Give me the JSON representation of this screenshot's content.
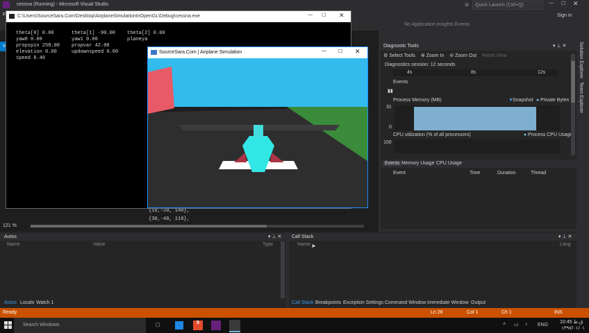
{
  "vs": {
    "title": "cessna (Running) - Microsoft Visual Studio",
    "quick_launch": "Quick Launch (Ctrl+Q)",
    "menu_file": "File",
    "sign_in": "Sign in",
    "app_insights": "No Application Insights Events",
    "editor_tab": "ver",
    "toolbar_left": "Pr"
  },
  "console": {
    "title": "C:\\Users\\SourceSara.Com\\Desktop\\AirplaneSimulationInOpenGL\\Debug\\cessna.exe",
    "col1": [
      "theta[0] 0.00",
      "yaw0 0.00",
      "propspin 258.00",
      "elevation 0.00",
      "speed 8.40"
    ],
    "col2": [
      "theta[1] -90.00",
      "yaw1 0.00",
      "propvar 42.00",
      "updownspeed 0.00"
    ],
    "col3": [
      "theta[2] 0.00",
      "planeya"
    ]
  },
  "airplane": {
    "title": "SourceSara.Com | Airplane Simulation"
  },
  "code": {
    "line1": "{10,-20, 140},",
    "line2": "{30,-40, 110},"
  },
  "editor": {
    "zoom": "121 %"
  },
  "diagnostics": {
    "title": "Diagnostic Tools",
    "select_tools": "Select Tools",
    "zoom_in": "Zoom In",
    "zoom_out": "Zoom Out",
    "reset_view": "Reset View",
    "session": "Diagnostics session: 12 seconds",
    "ticks": [
      "4s",
      "8s",
      "12s"
    ],
    "events_label": "Events",
    "process_memory": "Process Memory (MB)",
    "snapshot": "Snapshot",
    "private_bytes": "Private Bytes",
    "mem_top": "31",
    "mem_bottom": "0",
    "cpu_label": "CPU utilization (% of all processors)",
    "process_cpu": "Process CPU Usage",
    "cpu_top": "100",
    "tabs": [
      "Events",
      "Memory Usage",
      "CPU Usage"
    ],
    "columns": [
      "Event",
      "Time",
      "Duration",
      "Thread"
    ]
  },
  "autos": {
    "title": "Autos",
    "columns": [
      "Name",
      "Value",
      "Type"
    ],
    "tabs": [
      "Autos",
      "Locals",
      "Watch 1"
    ]
  },
  "callstack": {
    "title": "Call Stack",
    "columns": [
      "Name",
      "Lang"
    ],
    "tabs": [
      "Call Stack",
      "Breakpoints",
      "Exception Settings",
      "Command Window",
      "Immediate Window",
      "Output"
    ]
  },
  "status": {
    "ready": "Ready",
    "ln": "Ln 28",
    "col": "Col 1",
    "ch": "Ch 1",
    "ins": "INS"
  },
  "sidetabs": [
    "Solution Explorer",
    "Team Explorer"
  ],
  "taskbar": {
    "search": "Search Windows",
    "time": "10:45 ق.ظ",
    "date": "۱۳۹۷/۰۱/۰۱",
    "lang": "ENG"
  },
  "colors": {
    "status": "#ca5100",
    "accent": "#3e9be5",
    "sky": "#33bbee",
    "ground_green": "#3a8b3a",
    "nose": "#33e6e6"
  }
}
